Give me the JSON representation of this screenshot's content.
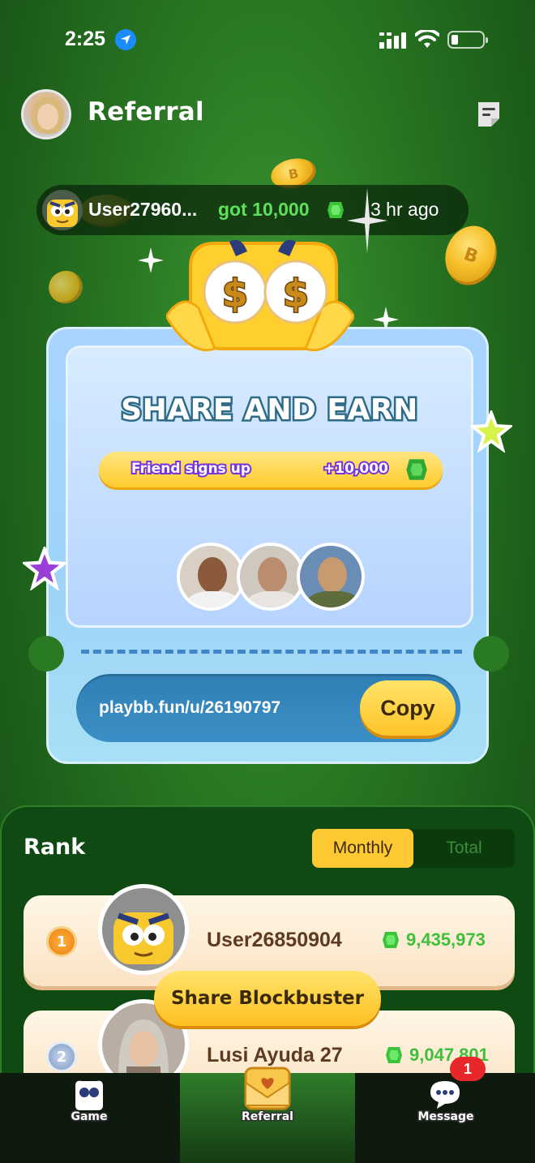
{
  "status_bar": {
    "time": "2:25"
  },
  "header": {
    "title": "Referral"
  },
  "ticker": {
    "user": "User27960...",
    "got": "got 10,000",
    "time": "3 hr ago"
  },
  "card": {
    "title": "SHARE AND EARN",
    "reward_label": "Friend signs up",
    "reward_value": "+10,000",
    "link": "playbb.fun/u/26190797",
    "copy_label": "Copy"
  },
  "rank": {
    "title": "Rank",
    "tabs": [
      "Monthly",
      "Total"
    ],
    "rows": [
      {
        "position": "1",
        "name": "User26850904",
        "score": "9,435,973"
      },
      {
        "position": "2",
        "name": "Lusi Ayuda 27",
        "score": "9,047,801"
      }
    ]
  },
  "share_button": "Share Blockbuster",
  "nav": {
    "items": [
      "Game",
      "Referral",
      "Message"
    ],
    "message_badge": "1"
  },
  "colors": {
    "accent": "#ffc933",
    "gem": "#3fbf3a",
    "badge": "#e8272b"
  }
}
